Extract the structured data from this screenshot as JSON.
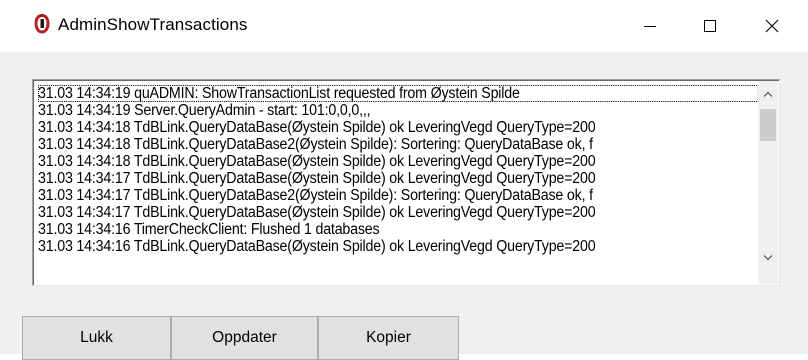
{
  "window": {
    "title": "AdminShowTransactions",
    "app_icon": "delphi-app-icon",
    "controls": [
      "minimize-icon",
      "maximize-icon",
      "close-icon"
    ]
  },
  "log": {
    "lines": [
      "31.03 14:34:19 quADMIN: ShowTransactionList requested from Øystein Spilde",
      "31.03 14:34:19 Server.QueryAdmin - start: 101:0,0,0,,,",
      "31.03 14:34:18 TdBLink.QueryDataBase(Øystein Spilde) ok LeveringVegd QueryType=200",
      "31.03 14:34:18 TdBLink.QueryDataBase2(Øystein Spilde): Sortering: QueryDataBase ok, f",
      "31.03 14:34:18 TdBLink.QueryDataBase(Øystein Spilde) ok LeveringVegd QueryType=200",
      "31.03 14:34:17 TdBLink.QueryDataBase(Øystein Spilde) ok LeveringVegd QueryType=200",
      "31.03 14:34:17 TdBLink.QueryDataBase2(Øystein Spilde): Sortering: QueryDataBase ok, f",
      "31.03 14:34:17 TdBLink.QueryDataBase(Øystein Spilde) ok LeveringVegd QueryType=200",
      "31.03 14:34:16 TimerCheckClient: Flushed 1 databases",
      "31.03 14:34:16 TdBLink.QueryDataBase(Øystein Spilde) ok LeveringVegd QueryType=200"
    ],
    "selected_index": 0
  },
  "buttons": {
    "close_label": "Lukk",
    "refresh_label": "Oppdater",
    "copy_label": "Kopier"
  }
}
